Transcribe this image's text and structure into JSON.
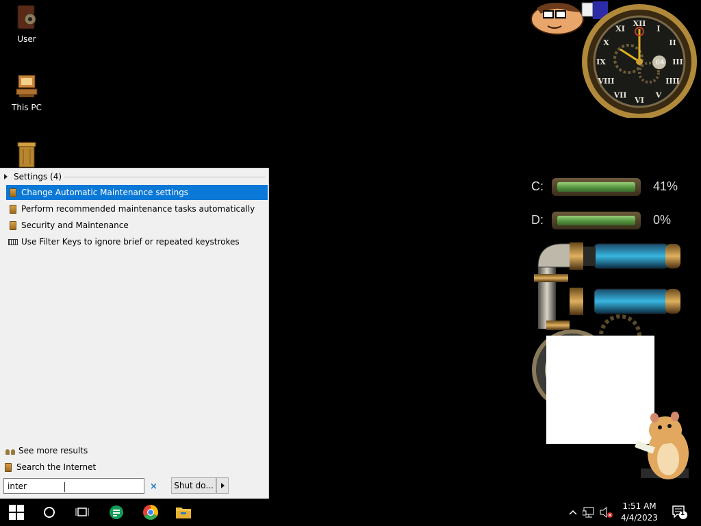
{
  "desktop": {
    "icons": [
      {
        "label": "User"
      },
      {
        "label": "This PC"
      },
      {
        "label": ""
      }
    ]
  },
  "widgets": {
    "clock": {
      "day": "04",
      "numerals": [
        "XII",
        "I",
        "II",
        "III",
        "IIII",
        "V",
        "VI",
        "VII",
        "VIII",
        "IX",
        "X",
        "XI"
      ]
    },
    "drives": [
      {
        "letter": "C:",
        "percent_text": "41%",
        "usage": 0.41
      },
      {
        "letter": "D:",
        "percent_text": "0%",
        "usage": 0.0
      }
    ]
  },
  "start_menu": {
    "group_header": "Settings (4)",
    "results": [
      {
        "label": "Change Automatic Maintenance settings",
        "icon": "settings-file-icon",
        "selected": true
      },
      {
        "label": "Perform recommended maintenance tasks automatically",
        "icon": "settings-file-icon",
        "selected": false
      },
      {
        "label": "Security and Maintenance",
        "icon": "settings-file-icon",
        "selected": false
      },
      {
        "label": "Use Filter Keys to ignore brief or repeated keystrokes",
        "icon": "keyboard-icon",
        "selected": false
      }
    ],
    "see_more": "See more results",
    "search_internet": "Search the Internet",
    "search_value": "inter",
    "clear_glyph": "×",
    "shutdown_label": "Shut do..."
  },
  "taskbar": {
    "time": "1:51 AM",
    "date": "4/4/2023",
    "notification_count": "1",
    "colors": {
      "start_blue": "#ffffff",
      "sheets_green": "#0f9d58",
      "folder_yellow": "#f2c144",
      "selection": "#0a78d7"
    }
  }
}
